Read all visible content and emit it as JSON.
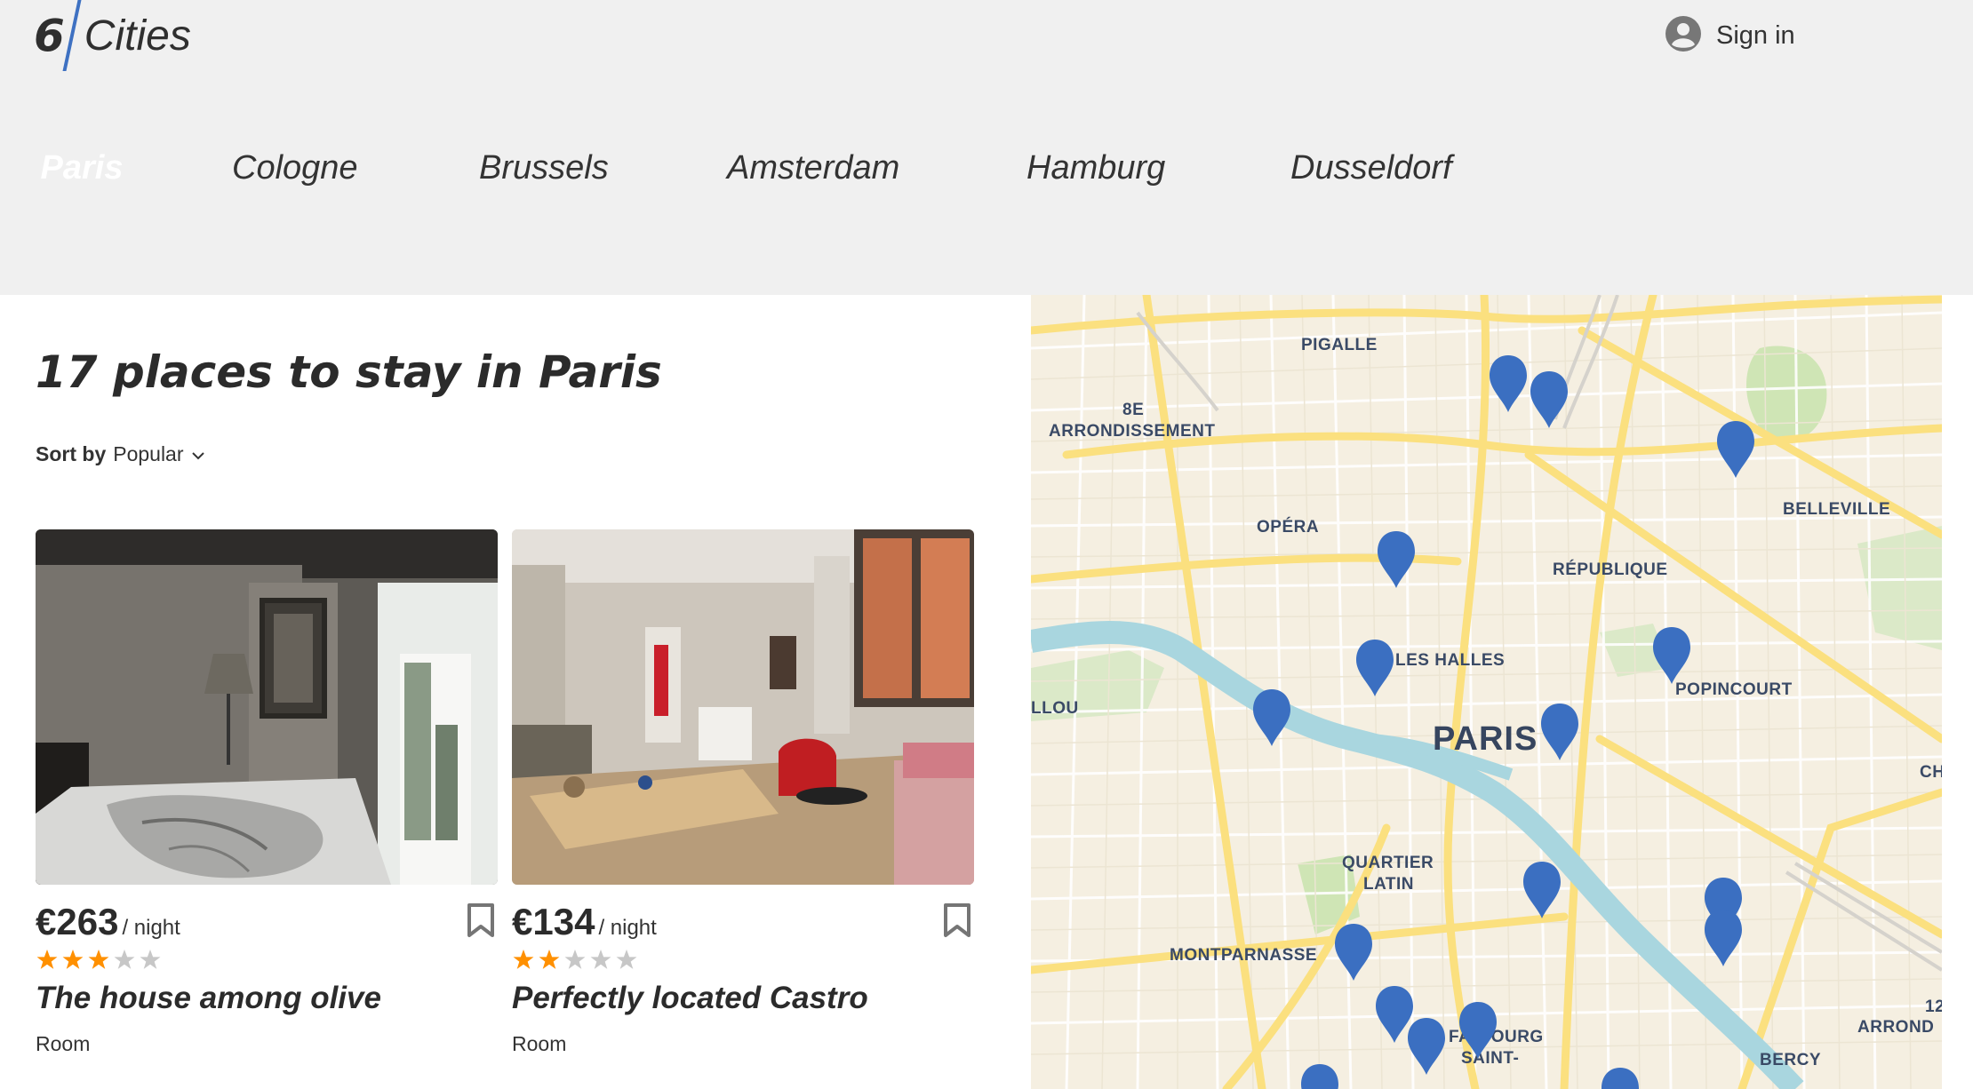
{
  "header": {
    "logo": {
      "number": "6",
      "word": "Cities"
    },
    "signin_label": "Sign in"
  },
  "tabs": [
    {
      "label": "Paris",
      "active": true
    },
    {
      "label": "Cologne",
      "active": false
    },
    {
      "label": "Brussels",
      "active": false
    },
    {
      "label": "Amsterdam",
      "active": false
    },
    {
      "label": "Hamburg",
      "active": false
    },
    {
      "label": "Dusseldorf",
      "active": false
    }
  ],
  "main": {
    "title": "17 places to stay in Paris",
    "sort": {
      "label": "Sort by",
      "value": "Popular"
    }
  },
  "offers": [
    {
      "price": "€263",
      "per": "/ night",
      "rating": 3,
      "name": "The house among olive",
      "type": "Room"
    },
    {
      "price": "€134",
      "per": "/ night",
      "rating": 2,
      "name": "Perfectly located Castro",
      "type": "Room"
    }
  ],
  "map": {
    "labels": {
      "pigalle": "PIGALLE",
      "arr8_a": "8E",
      "arr8_b": "ARRONDISSEMENT",
      "opera": "OPÉRA",
      "belleville": "BELLEVILLE",
      "republique": "RÉPUBLIQUE",
      "les_halles": "LES HALLES",
      "popincourt": "POPINCOURT",
      "llou": "LLOU",
      "paris": "PARIS",
      "cha": "CHA",
      "quartier_a": "QUARTIER",
      "quartier_b": "LATIN",
      "montparnasse": "MONTPARNASSE",
      "faubourg_a": "FA    OURG",
      "faubourg_b": "SAINT-",
      "arrond_a": "12",
      "arrond_b": "ARROND",
      "bercy": "BERCY"
    },
    "colors": {
      "marker": "#3b6fc1",
      "water": "#a9d6df",
      "road": "#fbe07f",
      "park": "#cfe5b5"
    }
  },
  "colors": {
    "accent": "#3a6fc1",
    "star_on": "#ff9000",
    "star_off": "#c7c7c7",
    "header_bg": "#f0f0f0"
  }
}
